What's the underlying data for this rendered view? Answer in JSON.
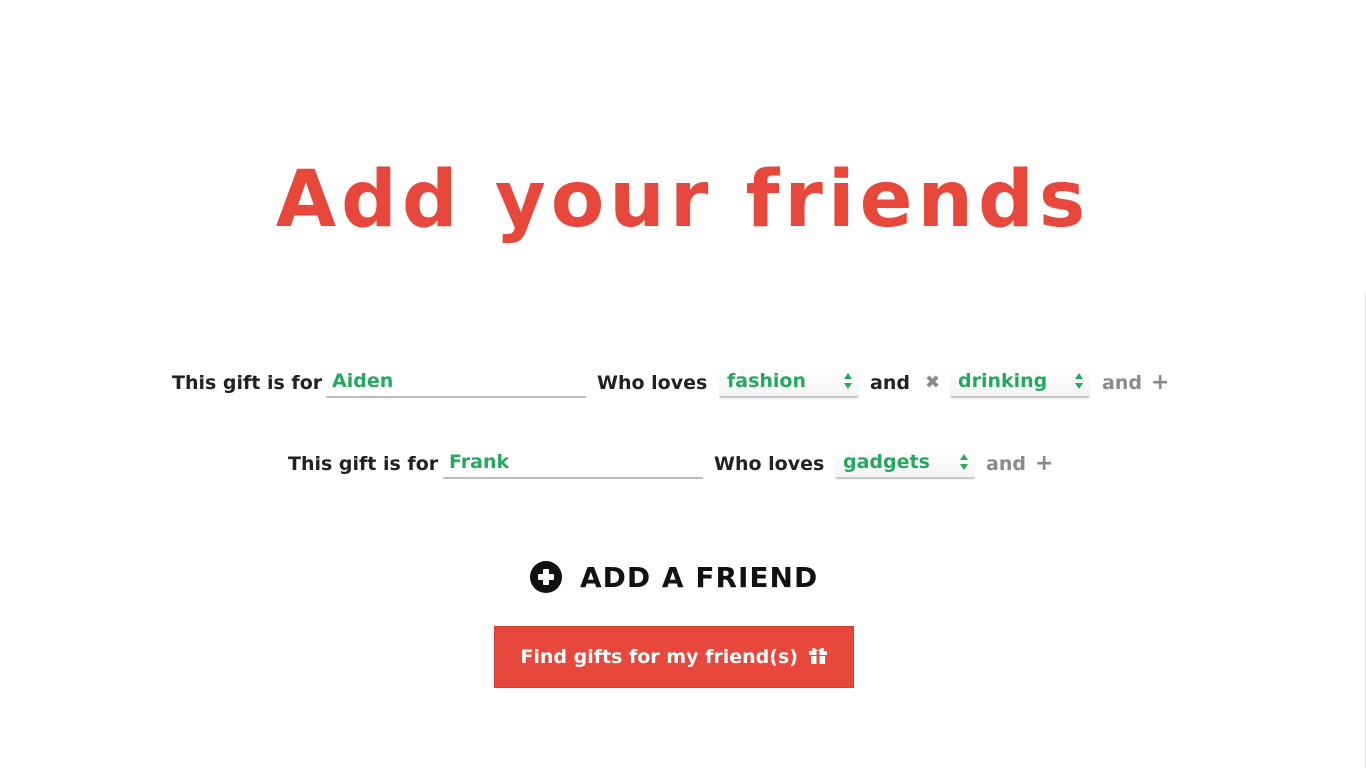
{
  "page": {
    "title": "Add your friends"
  },
  "friends": [
    {
      "prefix_label": "This gift is for",
      "name": "Aiden",
      "loves_label": "Who loves",
      "interests": [
        "fashion",
        "drinking"
      ],
      "and_label": "and",
      "trailing_and_label": "and"
    },
    {
      "prefix_label": "This gift is for",
      "name": "Frank",
      "loves_label": "Who loves",
      "interests": [
        "gadgets"
      ],
      "trailing_and_label": "and"
    }
  ],
  "add_friend": {
    "label": "ADD A FRIEND"
  },
  "find_button": {
    "label": "Find gifts for my friend(s)"
  },
  "icons": {
    "remove": "close-icon",
    "add_interest": "plus-icon",
    "add_friend": "plus-circle-icon",
    "select_arrows": "select-arrows-icon",
    "gift": "gift-icon"
  },
  "colors": {
    "accent_red": "#e8473b",
    "value_green": "#27a85f",
    "label_dark": "#222222",
    "muted_grey": "#8a8a8a"
  }
}
